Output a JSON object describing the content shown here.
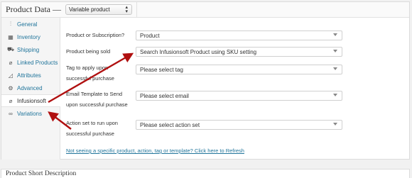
{
  "panel": {
    "title": "Product Data —",
    "product_type": "Variable product"
  },
  "tabs": [
    {
      "label": "General",
      "icon": "sliders-icon",
      "glyph": "⫶"
    },
    {
      "label": "Inventory",
      "icon": "inventory-icon",
      "glyph": "▦"
    },
    {
      "label": "Shipping",
      "icon": "truck-icon",
      "glyph": "⛟"
    },
    {
      "label": "Linked Products",
      "icon": "link-icon",
      "glyph": "⌀"
    },
    {
      "label": "Attributes",
      "icon": "tag-icon",
      "glyph": "◿"
    },
    {
      "label": "Advanced",
      "icon": "gear-icon",
      "glyph": "⚙"
    },
    {
      "label": "Infusionsoft",
      "icon": "link-icon",
      "glyph": "⌀"
    },
    {
      "label": "Variations",
      "icon": "variations-icon",
      "glyph": "∞"
    }
  ],
  "fields": [
    {
      "label": "Product or Subscription?",
      "value": "Product"
    },
    {
      "label": "Product being sold",
      "value": "Search Infusionsoft Product using SKU setting"
    },
    {
      "label": "Tag to apply upon successful purchase",
      "value": "Please select tag"
    },
    {
      "label": "Email Template to Send upon successful purchase",
      "value": "Please select email"
    },
    {
      "label": "Action set to run upon successful purchase",
      "value": "Please select action set"
    }
  ],
  "help_link": "Not seeing a specific product, action, tag or template? Click here to Refresh",
  "short_description_title": "Product Short Description",
  "colors": {
    "link": "#21759b",
    "arrow": "#b01010"
  }
}
